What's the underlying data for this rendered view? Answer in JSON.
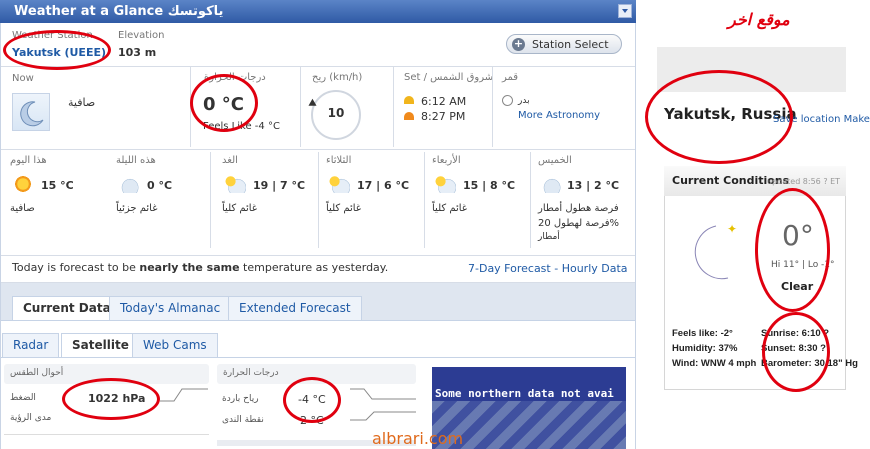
{
  "widget": {
    "title": "Weather at a Glance ياكوتسك",
    "station_label": "Weather Station",
    "station_name": "Yakutsk (UEEE)",
    "elevation_label": "Elevation",
    "elevation_value": "103 m",
    "station_select": "Station Select"
  },
  "now": {
    "label": "Now",
    "condition": "صافية",
    "temperature_label": "درجات الحرارة",
    "temperature": "0 °C",
    "feels_like": "Feels Like -4 °C",
    "wind_label": "ريح (km/h)",
    "wind_speed": "10",
    "sun_label": "Set / شروق الشمس",
    "sunrise": "6:12 AM",
    "sunset": "8:27 PM",
    "moon_label": "قمر",
    "moon_phase": "بدر",
    "more_astronomy": "More Astronomy"
  },
  "forecast": [
    {
      "day": "هذا اليوم",
      "temps": "15 °C",
      "desc": "صافية",
      "icon": "sunny-icon"
    },
    {
      "day": "هذه الليلة",
      "temps": "0 °C",
      "desc": "غائم جزئياً",
      "icon": "partly-cloudy-icon"
    },
    {
      "day": "الغد",
      "temps": "19 | 7 °C",
      "desc": "غائم كلياً",
      "icon": "cloudy-icon"
    },
    {
      "day": "الثلاثاء",
      "temps": "17 | 6 °C",
      "desc": "غائم كلياً",
      "icon": "cloudy-icon"
    },
    {
      "day": "الأربعاء",
      "temps": "15 | 8 °C",
      "desc": "غائم كلياً",
      "icon": "cloudy-icon"
    },
    {
      "day": "الخميس",
      "temps": "13 | 2 °C",
      "desc": "فرصة هطول أمطار",
      "desc2": "فرصة لهطول 20%",
      "desc3": "أمطار",
      "icon": "rain-icon"
    }
  ],
  "summary": {
    "prefix": "Today is forecast to be ",
    "bold": "nearly the same",
    "suffix": " temperature as yesterday.",
    "links": "7-Day Forecast - Hourly Data"
  },
  "tabs": [
    "Current Data",
    "Today's Almanac",
    "Extended Forecast"
  ],
  "subtabs": [
    "Radar",
    "Satellite",
    "Web Cams"
  ],
  "conditions": {
    "pressure_header": "أحوال الطقس",
    "pressure_label": "الضغط",
    "pressure_value": "1022 hPa",
    "visibility_label": "مدى الرؤية",
    "temp_header": "درجات الحرارة",
    "windchill_label": "رياح باردة",
    "windchill_value": "-4 °C",
    "dew_label": "نقطة الندى",
    "dew_value": "2 °C"
  },
  "satellite_text": "Some northern data not avai",
  "watermark": "albrari.com",
  "other": {
    "title": "موقع اخر",
    "location": "Yakutsk, Russia",
    "links": "Save location  Make",
    "cc_title": "Current Conditions",
    "cc_updated": "updated 8:56 ? ET",
    "temp": "0°",
    "hilo": "Hi 11° | Lo -1°",
    "condition": "Clear",
    "feels": "Feels like: -2°",
    "humidity": "Humidity: 37%",
    "wind": "Wind: WNW 4 mph",
    "sunrise": "Sunrise: 6:10 ?",
    "sunset": "Sunset: 8:30 ?",
    "barometer": "Barometer: 30.18\" Hg"
  }
}
